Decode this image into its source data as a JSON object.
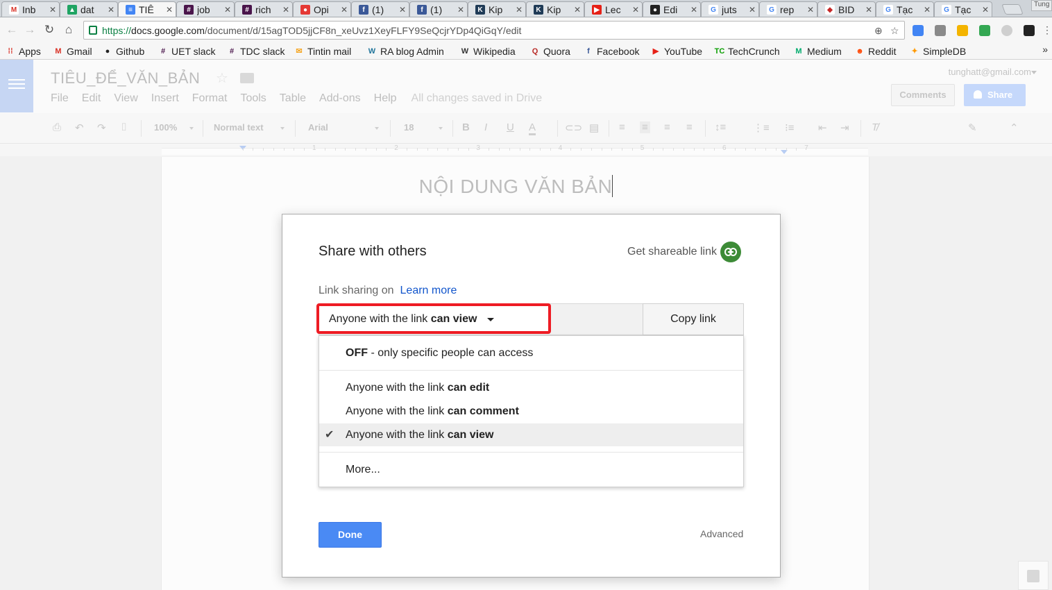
{
  "browser": {
    "tabs": [
      {
        "title": "Inb",
        "color": "#ffffff",
        "glyph": "M",
        "glyph_color": "#d93025"
      },
      {
        "title": "dat",
        "color": "#1fa463",
        "glyph": "▲",
        "glyph_color": "#ffffff"
      },
      {
        "title": "TIÊ",
        "color": "#4285f4",
        "glyph": "≡",
        "glyph_color": "#ffffff",
        "active": true
      },
      {
        "title": "job",
        "color": "#4a154b",
        "glyph": "#",
        "glyph_color": "#ffffff"
      },
      {
        "title": "rich",
        "color": "#4a154b",
        "glyph": "#",
        "glyph_color": "#ffffff"
      },
      {
        "title": "Opi",
        "color": "#e53935",
        "glyph": "●",
        "glyph_color": "#ffffff"
      },
      {
        "title": "(1)",
        "color": "#3b5998",
        "glyph": "f",
        "glyph_color": "#ffffff"
      },
      {
        "title": "(1)",
        "color": "#3b5998",
        "glyph": "f",
        "glyph_color": "#ffffff"
      },
      {
        "title": "Kip",
        "color": "#1f3b57",
        "glyph": "K",
        "glyph_color": "#ffffff"
      },
      {
        "title": "Kip",
        "color": "#1f3b57",
        "glyph": "K",
        "glyph_color": "#ffffff"
      },
      {
        "title": "Lec",
        "color": "#e62117",
        "glyph": "▶",
        "glyph_color": "#ffffff"
      },
      {
        "title": "Edi",
        "color": "#222222",
        "glyph": "●",
        "glyph_color": "#ffffff"
      },
      {
        "title": "juts",
        "color": "#ffffff",
        "glyph": "G",
        "glyph_color": "#4285f4"
      },
      {
        "title": "rep",
        "color": "#ffffff",
        "glyph": "G",
        "glyph_color": "#4285f4"
      },
      {
        "title": "BID",
        "color": "#ffffff",
        "glyph": "◆",
        "glyph_color": "#c62828"
      },
      {
        "title": "Tạc",
        "color": "#ffffff",
        "glyph": "G",
        "glyph_color": "#4285f4"
      },
      {
        "title": "Tạc",
        "color": "#ffffff",
        "glyph": "G",
        "glyph_color": "#4285f4"
      }
    ],
    "profile_label": "Tung",
    "url": {
      "scheme": "https://",
      "host": "docs.google.com",
      "path": "/document/d/15agTOD5jjCF8n_xeUvz1XeyFLFY9SeQcjrYDp4QiGqY/edit"
    },
    "bookmarks": [
      {
        "label": "Apps",
        "icon": "apps-icon",
        "color": "#d93025",
        "glyph": "⁞⁞"
      },
      {
        "label": "Gmail",
        "icon": "gmail-icon",
        "color": "#d93025",
        "glyph": "M"
      },
      {
        "label": "Github",
        "icon": "github-icon",
        "color": "#222222",
        "glyph": "●"
      },
      {
        "label": "UET slack",
        "icon": "slack-icon",
        "color": "#4a154b",
        "glyph": "#"
      },
      {
        "label": "TDC slack",
        "icon": "slack-icon",
        "color": "#4a154b",
        "glyph": "#"
      },
      {
        "label": "Tintin mail",
        "icon": "mail-icon",
        "color": "#f5a623",
        "glyph": "✉"
      },
      {
        "label": "RA blog Admin",
        "icon": "wordpress-icon",
        "color": "#21759b",
        "glyph": "W"
      },
      {
        "label": "Wikipedia",
        "icon": "wikipedia-icon",
        "color": "#333333",
        "glyph": "W"
      },
      {
        "label": "Quora",
        "icon": "quora-icon",
        "color": "#b92b27",
        "glyph": "Q"
      },
      {
        "label": "Facebook",
        "icon": "facebook-icon",
        "color": "#3b5998",
        "glyph": "f"
      },
      {
        "label": "YouTube",
        "icon": "youtube-icon",
        "color": "#e62117",
        "glyph": "▶"
      },
      {
        "label": "TechCrunch",
        "icon": "techcrunch-icon",
        "color": "#0a9e01",
        "glyph": "TC"
      },
      {
        "label": "Medium",
        "icon": "medium-icon",
        "color": "#00ab6c",
        "glyph": "M"
      },
      {
        "label": "Reddit",
        "icon": "reddit-icon",
        "color": "#ff4500",
        "glyph": "☻"
      },
      {
        "label": "SimpleDB",
        "icon": "simpledb-icon",
        "color": "#f90",
        "glyph": "✦"
      }
    ],
    "bookmarks_overflow": "»"
  },
  "docs": {
    "title": "TIÊU_ĐỂ_VĂN_BẢN",
    "menu": [
      "File",
      "Edit",
      "View",
      "Insert",
      "Format",
      "Tools",
      "Table",
      "Add-ons",
      "Help"
    ],
    "save_status": "All changes saved in Drive",
    "account": "tunghatt@gmail.com",
    "comments_label": "Comments",
    "share_label": "Share",
    "toolbar": {
      "zoom": "100%",
      "style": "Normal text",
      "font": "Arial",
      "size": "18"
    },
    "ruler_numbers": [
      "1",
      "2",
      "3",
      "4",
      "5",
      "6",
      "7"
    ],
    "body_text": "NỘI DUNG VĂN BẢN"
  },
  "dialog": {
    "title": "Share with others",
    "get_link_label": "Get shareable link",
    "sharing_status": "Link sharing on",
    "learn_more": "Learn more",
    "access": {
      "prefix": "Anyone with the link ",
      "bold": "can view"
    },
    "copy_link": "Copy link",
    "options": [
      {
        "bold": "OFF",
        "rest": " - only specific people can access",
        "bold_first": true,
        "selected": false
      },
      {
        "prefix": "Anyone with the link ",
        "bold": "can edit",
        "selected": false
      },
      {
        "prefix": "Anyone with the link ",
        "bold": "can comment",
        "selected": false
      },
      {
        "prefix": "Anyone with the link ",
        "bold": "can view",
        "selected": true
      },
      {
        "plain": "More...",
        "selected": false
      }
    ],
    "done_label": "Done",
    "advanced_label": "Advanced",
    "highlight_color": "#ee1c24"
  }
}
